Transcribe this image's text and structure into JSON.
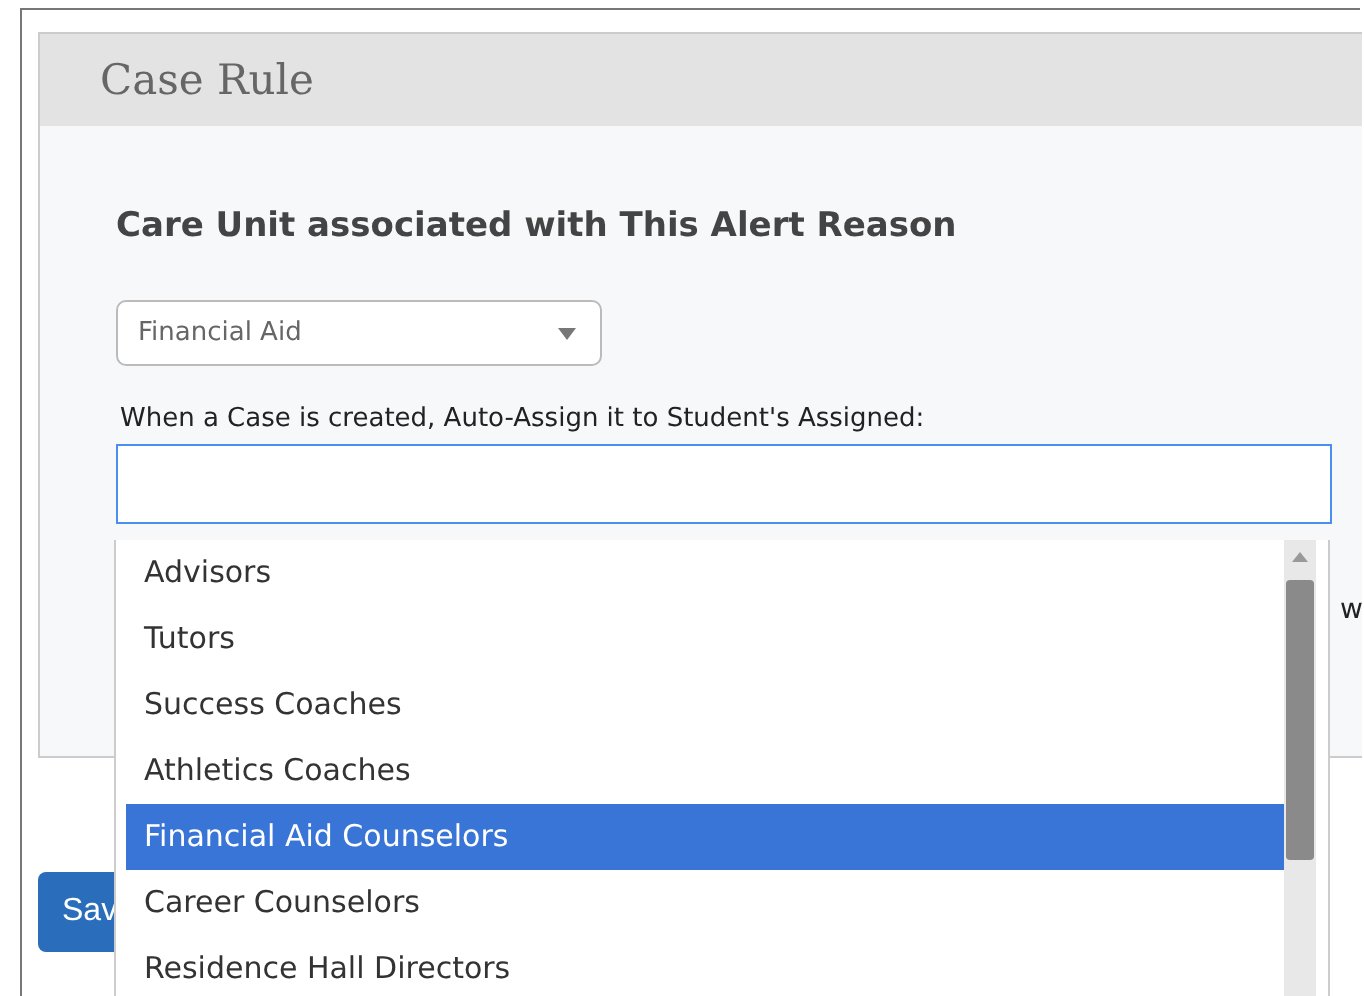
{
  "panel": {
    "title": "Case Rule",
    "heading": "Care Unit associated with This Alert Reason",
    "care_unit_select": {
      "value": "Financial Aid"
    },
    "assign_label": "When a Case is created, Auto-Assign it to Student's Assigned:",
    "cut_text": "w"
  },
  "save_button": {
    "label": "Sav"
  },
  "dropdown": {
    "options": [
      {
        "label": "Advisors",
        "selected": false
      },
      {
        "label": "Tutors",
        "selected": false
      },
      {
        "label": "Success Coaches",
        "selected": false
      },
      {
        "label": "Athletics Coaches",
        "selected": false
      },
      {
        "label": "Financial Aid Counselors",
        "selected": true
      },
      {
        "label": "Career Counselors",
        "selected": false
      },
      {
        "label": "Residence Hall Directors",
        "selected": false
      }
    ]
  }
}
